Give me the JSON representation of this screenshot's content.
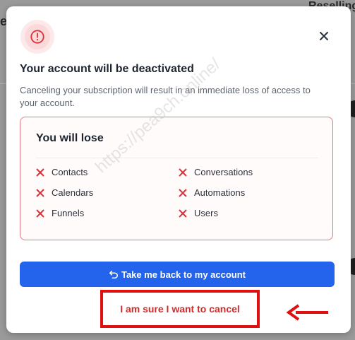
{
  "background": {
    "right_title": "Reselling",
    "left_letter": "e"
  },
  "modal": {
    "title": "Your account will be deactivated",
    "description": "Canceling your subscription will result in an immediate loss of access to your account.",
    "lose_title": "You will lose",
    "lose_items": [
      "Contacts",
      "Conversations",
      "Calendars",
      "Automations",
      "Funnels",
      "Users"
    ],
    "back_button_label": "Take me back to my account",
    "cancel_label": "I am sure I want to cancel"
  },
  "watermark": "https://pea9ch.online/",
  "colors": {
    "accent_blue": "#2463eb",
    "danger_red": "#d32b2b",
    "highlight_red": "#e01010"
  }
}
